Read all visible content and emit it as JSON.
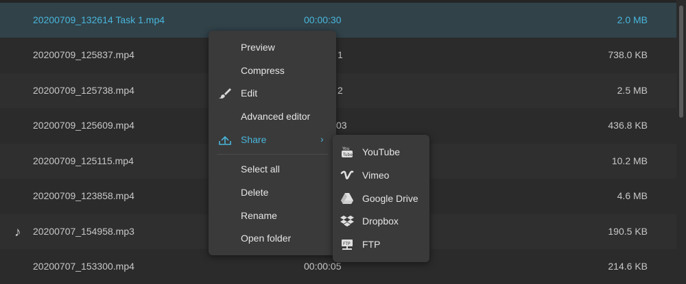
{
  "files": [
    {
      "name": "20200709_132614 Task 1.mp4",
      "duration": "00:00:30",
      "size": "2.0 MB",
      "selected": true
    },
    {
      "name": "20200709_125837.mp4",
      "duration": "1",
      "size": "738.0 KB"
    },
    {
      "name": "20200709_125738.mp4",
      "duration": "2",
      "size": "2.5 MB"
    },
    {
      "name": "20200709_125609.mp4",
      "duration": "03",
      "size": "436.8 KB"
    },
    {
      "name": "20200709_125115.mp4",
      "duration": "",
      "size": "10.2 MB"
    },
    {
      "name": "20200709_123858.mp4",
      "duration": "",
      "size": "4.6 MB"
    },
    {
      "name": "20200707_154958.mp3",
      "duration": "",
      "size": "190.5 KB",
      "icon": "music-note-icon"
    },
    {
      "name": "20200707_153300.mp4",
      "duration": "00:00:05",
      "size": "214.6 KB"
    }
  ],
  "context_menu": {
    "items": [
      {
        "label": "Preview"
      },
      {
        "label": "Compress"
      },
      {
        "label": "Edit",
        "icon": "brush-icon"
      },
      {
        "label": "Advanced editor"
      },
      {
        "label": "Share",
        "icon": "upload-cloud-icon",
        "has_submenu": true,
        "active": true
      },
      {
        "label": "Select all"
      },
      {
        "label": "Delete"
      },
      {
        "label": "Rename"
      },
      {
        "label": "Open folder"
      }
    ],
    "submenu_arrow": "›"
  },
  "share_submenu": {
    "items": [
      {
        "label": "YouTube",
        "icon": "youtube-icon"
      },
      {
        "label": "Vimeo",
        "icon": "vimeo-icon"
      },
      {
        "label": "Google Drive",
        "icon": "google-drive-icon"
      },
      {
        "label": "Dropbox",
        "icon": "dropbox-icon"
      },
      {
        "label": "FTP",
        "icon": "ftp-icon"
      }
    ]
  },
  "colors": {
    "background": "#2b2b2b",
    "selected_row": "#314249",
    "accent": "#49b7dd",
    "menu_bg": "#3a3a3a"
  }
}
